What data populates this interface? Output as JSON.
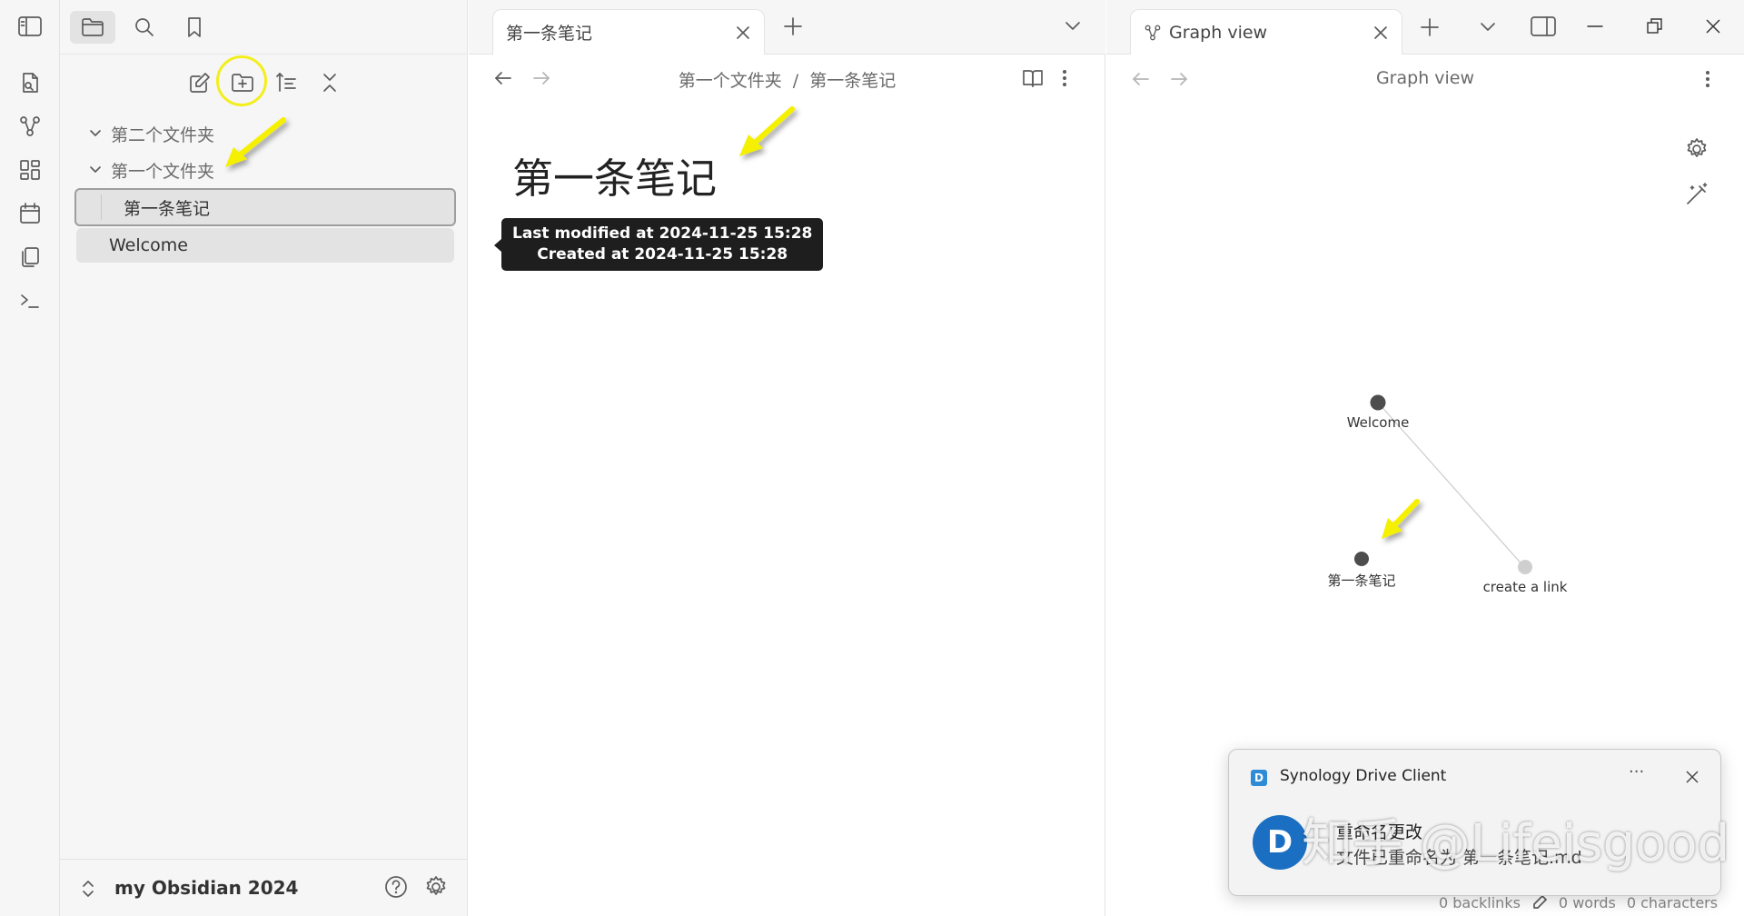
{
  "ribbon": {
    "items": [
      "open-quick-switcher-icon",
      "graph-icon",
      "canvas-icon",
      "calendar-icon",
      "templates-icon",
      "command-palette-icon"
    ]
  },
  "sidebar": {
    "tabs": [
      "files",
      "search",
      "bookmarks"
    ],
    "actions": [
      "new-note",
      "new-folder",
      "sort",
      "collapse-all"
    ],
    "tree": [
      {
        "label": "第二个文件夹",
        "type": "folder"
      },
      {
        "label": "第一个文件夹",
        "type": "folder"
      },
      {
        "label": "第一条笔记",
        "type": "note",
        "selected": true
      },
      {
        "label": "Welcome",
        "type": "note"
      }
    ],
    "vault_name": "my Obsidian 2024"
  },
  "middle": {
    "tab_title": "第一条笔记",
    "breadcrumb_folder": "第一个文件夹",
    "breadcrumb_sep": "/",
    "breadcrumb_note": "第一条笔记",
    "note_title": "第一条笔记",
    "tooltip_modified": "Last modified at 2024-11-25 15:28",
    "tooltip_created": "Created at 2024-11-25 15:28"
  },
  "right": {
    "tab_title": "Graph view",
    "header_title": "Graph view",
    "graph_nodes": [
      {
        "label": "Welcome"
      },
      {
        "label": "第一条笔记"
      },
      {
        "label": "create a link"
      }
    ]
  },
  "toast": {
    "app_name": "Synology Drive Client",
    "more": "···",
    "title": "重命名更改",
    "message": "文件已重命名为 第一条笔记.md",
    "watermark": "知乎 @Lifeisgood"
  },
  "status": {
    "backlinks": "0 backlinks",
    "words": "0 words",
    "characters": "0 characters"
  },
  "colors": {
    "highlight_circle": "#f3ee1d",
    "arrow": "#f5f000",
    "node_dark": "#4d4d4d",
    "node_light": "#cfcfcf"
  }
}
